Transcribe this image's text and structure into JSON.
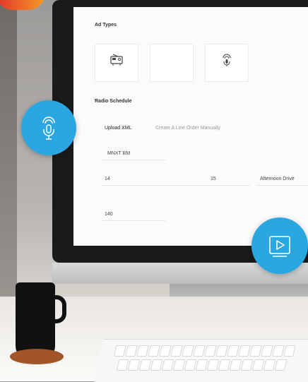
{
  "screen": {
    "ad_types_title": "Ad Types",
    "ad_types": [
      {
        "icon": "radio-icon",
        "label": ""
      },
      {
        "icon": "blank-icon",
        "label": ""
      },
      {
        "icon": "podcast-icon",
        "label": ""
      }
    ],
    "radio_schedule_title": "Radio Schedule",
    "tabs": [
      {
        "label": "Upload XML",
        "active": true
      },
      {
        "label": "Create A Line Order Manually",
        "active": false
      }
    ],
    "fields": {
      "station_label": "",
      "station_value": "MNXT BM",
      "week_label": "",
      "week_value": "14",
      "spots_label": "",
      "spots_value": "15",
      "daypart_label": "",
      "daypart_value": "Afternoon Drive",
      "budget_label": "",
      "budget_value": "140"
    }
  },
  "floating_icons": {
    "left": "podcast-mic-icon",
    "right": "video-play-icon"
  },
  "colors": {
    "accent_blue": "#2aa7e1",
    "corner_red": "#e2332c",
    "corner_orange": "#f59b25"
  }
}
